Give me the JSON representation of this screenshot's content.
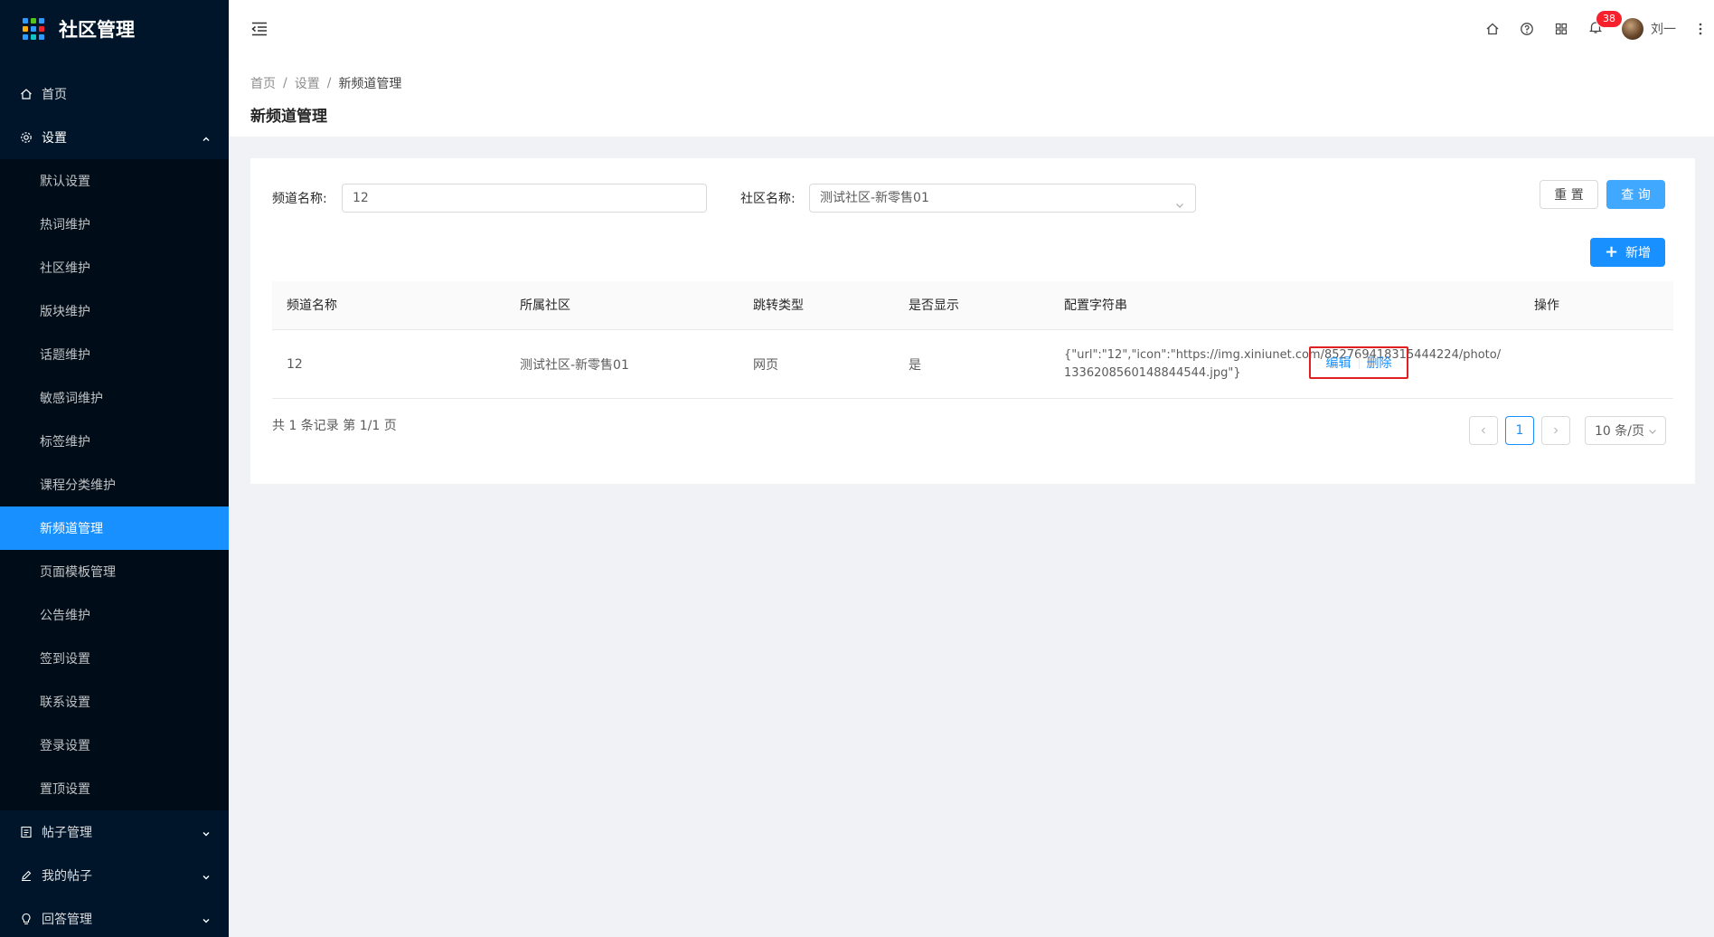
{
  "app": {
    "title": "社区管理"
  },
  "sidebar": {
    "items": [
      {
        "label": "首页",
        "icon": "home-icon"
      },
      {
        "label": "设置",
        "icon": "gear-icon",
        "expanded": true
      }
    ],
    "settings_children": [
      {
        "label": "默认设置"
      },
      {
        "label": "热词维护"
      },
      {
        "label": "社区维护"
      },
      {
        "label": "版块维护"
      },
      {
        "label": "话题维护"
      },
      {
        "label": "敏感词维护"
      },
      {
        "label": "标签维护"
      },
      {
        "label": "课程分类维护"
      },
      {
        "label": "新频道管理",
        "active": true
      },
      {
        "label": "页面模板管理"
      },
      {
        "label": "公告维护"
      },
      {
        "label": "签到设置"
      },
      {
        "label": "联系设置"
      },
      {
        "label": "登录设置"
      },
      {
        "label": "置顶设置"
      }
    ],
    "bottom_items": [
      {
        "label": "帖子管理",
        "icon": "document-icon"
      },
      {
        "label": "我的帖子",
        "icon": "pen-icon"
      },
      {
        "label": "回答管理",
        "icon": "bulb-icon"
      }
    ]
  },
  "header": {
    "notification_count": "38",
    "user_name": "刘一"
  },
  "breadcrumb": [
    "首页",
    "设置",
    "新频道管理"
  ],
  "page_title": "新频道管理",
  "filters": {
    "channel_label": "频道名称:",
    "channel_value": "12",
    "community_label": "社区名称:",
    "community_value": "测试社区-新零售01",
    "reset_label": "重 置",
    "query_label": "查 询",
    "add_label": "新增"
  },
  "table": {
    "columns": [
      "频道名称",
      "所属社区",
      "跳转类型",
      "是否显示",
      "配置字符串",
      "操作"
    ],
    "rows": [
      {
        "name": "12",
        "community": "测试社区-新零售01",
        "jump_type": "网页",
        "visible": "是",
        "config": "{\"url\":\"12\",\"icon\":\"https://img.xiniunet.com/852769418315444224/photo/1336208560148844544.jpg\"}",
        "edit_label": "编辑",
        "delete_label": "删除"
      }
    ]
  },
  "pagination": {
    "summary": "共 1 条记录 第 1/1 页",
    "current_page": "1",
    "page_size": "10 条/页"
  },
  "colors": {
    "sidebar_bg": "#001529",
    "accent": "#1890ff",
    "highlight_border": "#e02020",
    "badge": "#f5222d"
  }
}
